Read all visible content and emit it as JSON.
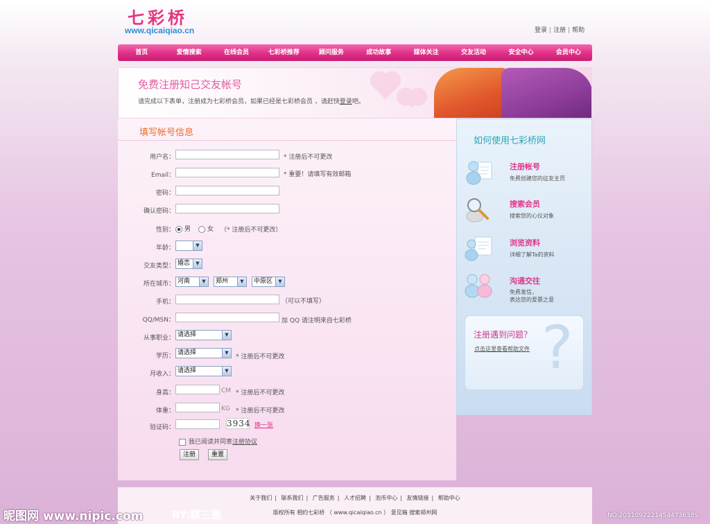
{
  "site": {
    "logo_cn": "七彩桥",
    "logo_url": "www.qicaiqiao.cn",
    "top_links": [
      "登录",
      "注册",
      "帮助"
    ]
  },
  "nav": {
    "items": [
      "首页",
      "爱情搜索",
      "在线会员",
      "七彩桥推荐",
      "顾问服务",
      "成功故事",
      "媒体关注",
      "交友活动",
      "安全中心",
      "会员中心"
    ]
  },
  "banner": {
    "title": "免费注册知己交友帐号",
    "desc_prefix": "请完成以下表单，注册成为七彩桥会员，如果已经是七彩桥会员 ，请赶快",
    "desc_link": "登录",
    "desc_suffix": "吧。"
  },
  "form": {
    "heading": "填写帐号信息",
    "username_label": "用户名：",
    "username_note": "* 注册后不可更改",
    "email_label": "Email：",
    "email_note": "* 重要！请填写有效邮箱",
    "password_label": "密码：",
    "confirm_label": "确认密码：",
    "gender_label": "性别：",
    "gender_male": "男",
    "gender_female": "女",
    "gender_note": "（* 注册后不可更改）",
    "age_label": "年龄：",
    "age_value": "",
    "dating_label": "交友类型：",
    "dating_value": "婚恋",
    "city_label": "所在城市：",
    "province_value": "河南",
    "city_value": "郑州",
    "district_value": "中原区",
    "mobile_label": "手机：",
    "mobile_note": "（可以不填写）",
    "qq_label": "QQ/MSN：",
    "qq_note": "加 QQ 请注明来自七彩桥",
    "job_label": "从事职业：",
    "job_value": "请选择",
    "edu_label": "学历：",
    "edu_value": "请选择",
    "edu_note": "* 注册后不可更改",
    "income_label": "月收入：",
    "income_value": "请选择",
    "height_label": "身高：",
    "height_unit": "CM",
    "height_note": "* 注册后不可更改",
    "weight_label": "体重：",
    "weight_unit": "KG",
    "weight_note": "* 注册后不可更改",
    "captcha_label": "验证码：",
    "captcha_value": "3934",
    "captcha_refresh": "换一张",
    "agree_prefix": "我已阅读并同意",
    "agree_link": "注册协议",
    "submit_label": "注册",
    "reset_label": "重置"
  },
  "help": {
    "title": "如何使用七彩桥网",
    "steps": [
      {
        "title": "注册帐号",
        "desc": "免费创建您的征友主页",
        "desc2": ""
      },
      {
        "title": "搜索会员",
        "desc": "搜索您的心仪对象",
        "desc2": ""
      },
      {
        "title": "浏览资料",
        "desc": "详细了解Ta的资料",
        "desc2": ""
      },
      {
        "title": "沟通交往",
        "desc": "免费发信，",
        "desc2": "表达您的爱慕之意"
      }
    ],
    "question_title": "注册遇到问题？",
    "question_link": "点击这里查看帮助文件",
    "question_mark": "?"
  },
  "footer": {
    "links": [
      "关于我们",
      "联系我们",
      "广告服务",
      "人才招聘",
      "泡币中心",
      "友情链接",
      "帮助中心"
    ],
    "copyright": "版权所有  相约七彩桥 （ www.qicaiqiao.cn ） 意见箱  搜索郑州网"
  },
  "watermark": {
    "left": "昵图网 www.nipic.com",
    "mid": "BY:蔡三墨",
    "right": "NO:20110922214544736389"
  },
  "colors": {
    "brand_pink": "#e02f87",
    "heading_orange": "#ec6d23",
    "help_teal": "#29a5b8"
  }
}
